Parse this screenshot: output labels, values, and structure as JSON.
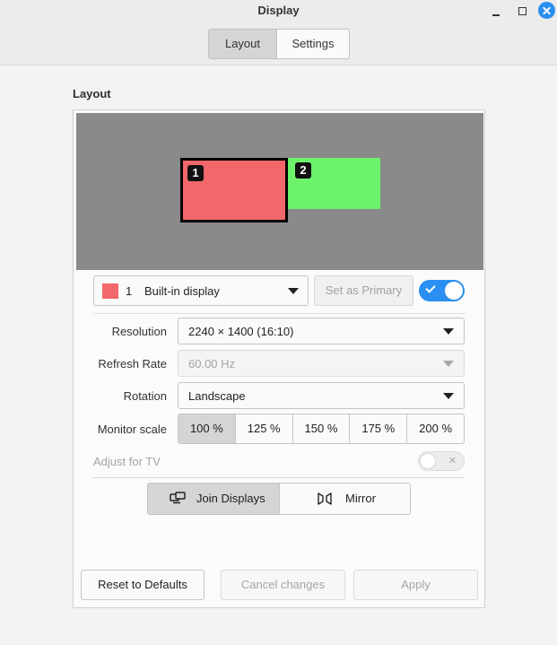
{
  "window": {
    "title": "Display"
  },
  "tabs": [
    {
      "label": "Layout",
      "active": true
    },
    {
      "label": "Settings",
      "active": false
    }
  ],
  "section_title": "Layout",
  "preview": {
    "background": "#8a8a8a",
    "monitors": [
      {
        "number": "1",
        "color": "#f2676a",
        "selected": true
      },
      {
        "number": "2",
        "color": "#6cf26b",
        "selected": false
      }
    ]
  },
  "monitor_select": {
    "swatch_color": "#f2676a",
    "number": "1",
    "name": "Built-in display"
  },
  "set_primary_label": "Set as Primary",
  "monitor_enabled": true,
  "settings": {
    "resolution": {
      "label": "Resolution",
      "value": "2240 × 1400 (16:10)"
    },
    "refresh_rate": {
      "label": "Refresh Rate",
      "value": "60.00 Hz",
      "disabled": true
    },
    "rotation": {
      "label": "Rotation",
      "value": "Landscape"
    },
    "monitor_scale": {
      "label": "Monitor scale",
      "options": [
        "100 %",
        "125 %",
        "150 %",
        "175 %",
        "200 %"
      ],
      "selected": "100 %"
    },
    "adjust_tv": {
      "label": "Adjust for TV",
      "enabled": false
    }
  },
  "modes": [
    {
      "label": "Join Displays",
      "active": true,
      "icon": "join-displays-icon"
    },
    {
      "label": "Mirror",
      "active": false,
      "icon": "mirror-icon"
    }
  ],
  "buttons": {
    "reset": "Reset to Defaults",
    "cancel": "Cancel changes",
    "apply": "Apply"
  },
  "accent_color": "#2a8ff0"
}
